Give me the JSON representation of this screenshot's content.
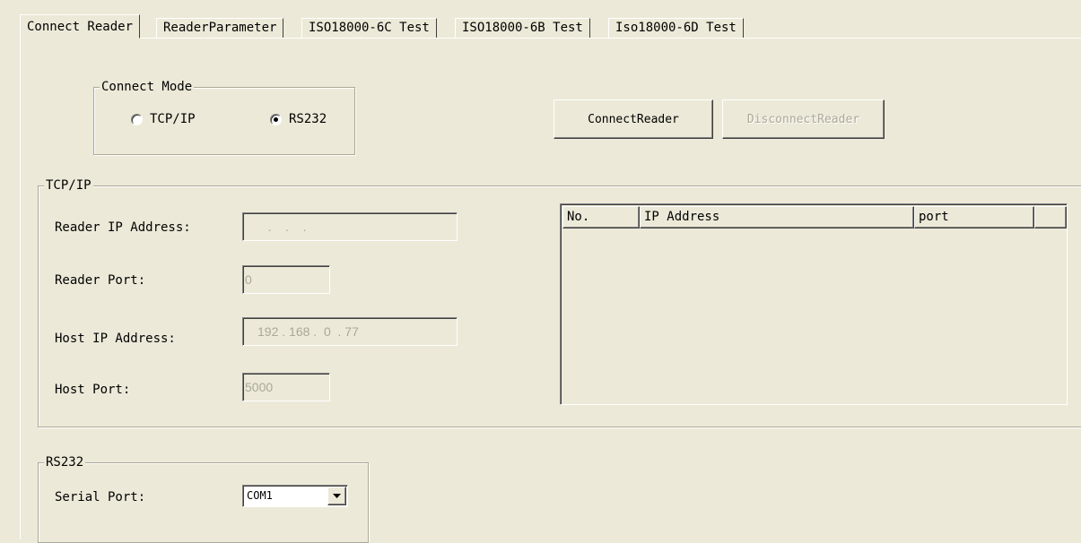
{
  "tabs": [
    {
      "label": "Connect Reader",
      "active": true
    },
    {
      "label": "ReaderParameter",
      "active": false
    },
    {
      "label": "ISO18000-6C Test",
      "active": false
    },
    {
      "label": "ISO18000-6B Test",
      "active": false
    },
    {
      "label": "Iso18000-6D Test",
      "active": false
    }
  ],
  "connect_mode": {
    "legend": "Connect Mode",
    "options": [
      {
        "label": "TCP/IP",
        "checked": false
      },
      {
        "label": "RS232",
        "checked": true
      }
    ]
  },
  "buttons": {
    "connect": "ConnectReader",
    "disconnect": "DisconnectReader"
  },
  "tcpip": {
    "legend": "TCP/IP",
    "reader_ip_label": "Reader IP Address:",
    "reader_ip_value": "   .    .    .   ",
    "reader_port_label": "Reader Port:",
    "reader_port_value": "0",
    "host_ip_label": "Host IP Address:",
    "host_ip_value": "192 . 168 .  0  . 77",
    "host_port_label": "Host Port:",
    "host_port_value": "5000"
  },
  "listview": {
    "columns": [
      "No.",
      "IP Address",
      "port",
      ""
    ]
  },
  "rs232": {
    "legend": "RS232",
    "serial_port_label": "Serial Port:",
    "serial_port_value": "COM1"
  },
  "colors": {
    "window_bg": "#ece9d8",
    "disabled_text": "#aca899"
  },
  "icons": {
    "combo_arrow": "chevron-down-icon"
  }
}
